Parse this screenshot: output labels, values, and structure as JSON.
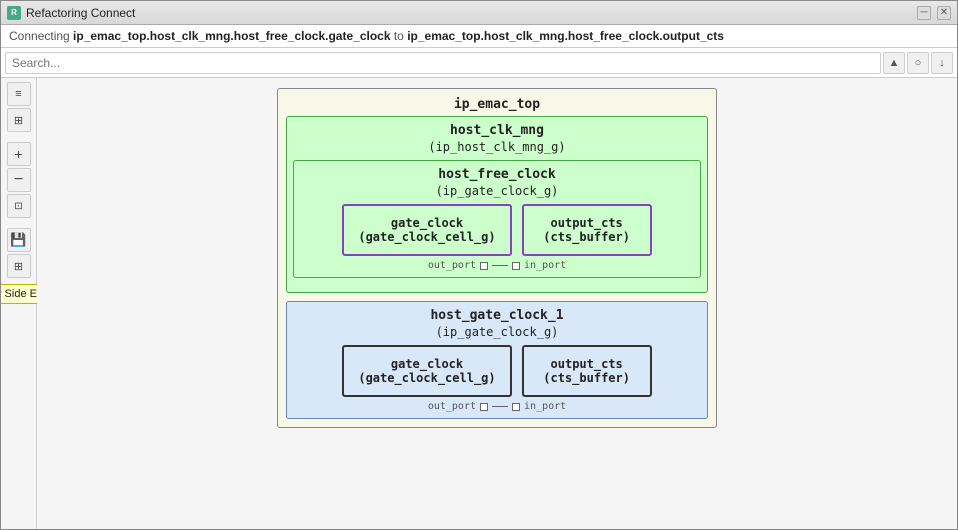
{
  "window": {
    "title": "Refactoring Connect",
    "close_label": "✕",
    "min_label": "─"
  },
  "connecting_bar": {
    "prefix": "Connecting ",
    "source": "ip_emac_top.host_clk_mng.host_free_clock.gate_clock",
    "to": " to ",
    "target": "ip_emac_top.host_clk_mng.host_free_clock.output_cts"
  },
  "toolbar": {
    "search_placeholder": "Search...",
    "btn1": "▲",
    "btn2": "○",
    "btn3": "↓"
  },
  "left_toolbar": {
    "btn_list": "≡",
    "btn_grid": "⊞",
    "btn_zoom_in": "🔍",
    "btn_zoom_out": "🔍",
    "btn_fit": "⊡",
    "btn_save": "💾",
    "btn_layout": "⊞",
    "show_side_effects": "Show Side Effects"
  },
  "diagram": {
    "outer_title": "ip_emac_top",
    "top_module": {
      "title": "host_clk_mng",
      "subtitle": "(ip_host_clk_mng_g)",
      "inner": {
        "title": "host_free_clock",
        "subtitle": "(ip_gate_clock_g)",
        "left_box": {
          "title": "gate_clock",
          "subtitle": "(gate_clock_cell_g)"
        },
        "right_box": {
          "title": "output_cts",
          "subtitle": "(cts_buffer)"
        },
        "port_left": "out_port",
        "port_right": "in_port"
      }
    },
    "bottom_module": {
      "title": "host_gate_clock_1",
      "subtitle": "(ip_gate_clock_g)",
      "left_box": {
        "title": "gate_clock",
        "subtitle": "(gate_clock_cell_g)"
      },
      "right_box": {
        "title": "output_cts",
        "subtitle": "(cts_buffer)"
      },
      "port_left": "out_port",
      "port_right": "in_port"
    }
  }
}
